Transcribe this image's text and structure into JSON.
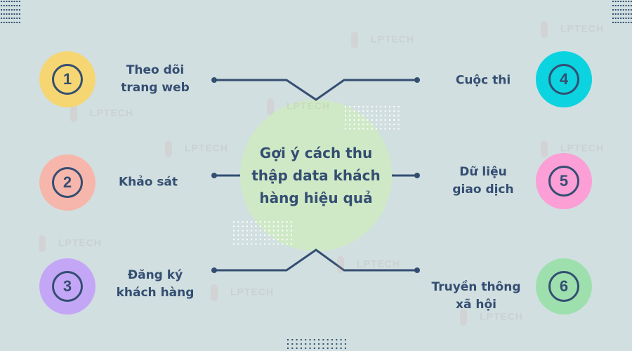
{
  "title": "Gợi ý cách thu thập data khách hàng hiệu quả",
  "title_lines": [
    "Gợi ý cách thu",
    "thập data khách",
    "hàng hiệu quả"
  ],
  "watermark_text": "LPTECH",
  "colors": {
    "background": "#d1dfe0",
    "text": "#344e72",
    "connector": "#344e72",
    "center_circle": "#cfe9c6"
  },
  "items": [
    {
      "number": "1",
      "lines": [
        "Theo dõi",
        "trang web"
      ],
      "color": "#f6d673",
      "side": "left"
    },
    {
      "number": "2",
      "lines": [
        "Khảo sát"
      ],
      "color": "#f7b6ab",
      "side": "left"
    },
    {
      "number": "3",
      "lines": [
        "Đăng ký",
        "khách hàng"
      ],
      "color": "#c4a6f6",
      "side": "left"
    },
    {
      "number": "4",
      "lines": [
        "Cuộc thi"
      ],
      "color": "#0bd3e0",
      "side": "right"
    },
    {
      "number": "5",
      "lines": [
        "Dữ liệu",
        "giao dịch"
      ],
      "color": "#fb9fd6",
      "side": "right"
    },
    {
      "number": "6",
      "lines": [
        "Truyền thông",
        "xã hội"
      ],
      "color": "#9de0ae",
      "side": "right"
    }
  ]
}
